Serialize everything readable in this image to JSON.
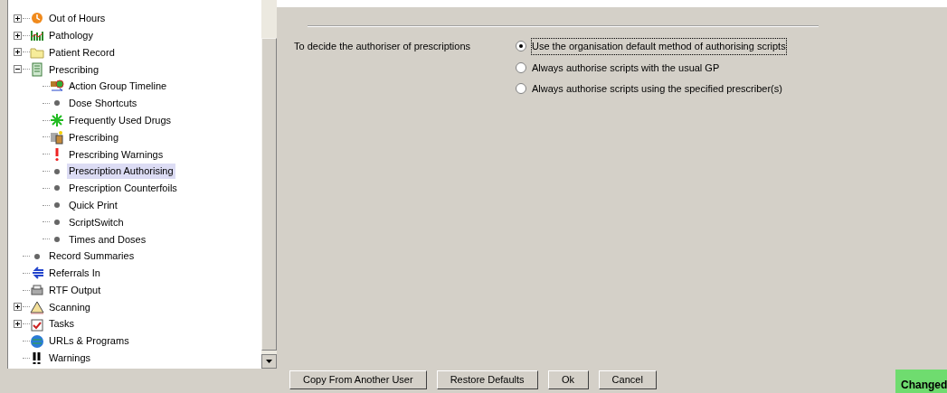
{
  "tree": {
    "items": [
      {
        "label": "Out of Hours",
        "kind": "branch",
        "expanded": false,
        "selected": false
      },
      {
        "label": "Pathology",
        "kind": "branch",
        "expanded": false,
        "selected": false
      },
      {
        "label": "Patient Record",
        "kind": "branch",
        "expanded": false,
        "selected": false
      },
      {
        "label": "Prescribing",
        "kind": "branch",
        "expanded": true,
        "selected": false,
        "children": [
          {
            "label": "Action Group Timeline",
            "selected": false
          },
          {
            "label": "Dose Shortcuts",
            "selected": false
          },
          {
            "label": "Frequently Used Drugs",
            "selected": false
          },
          {
            "label": "Prescribing",
            "selected": false
          },
          {
            "label": "Prescribing Warnings",
            "selected": false
          },
          {
            "label": "Prescription Authorising",
            "selected": true
          },
          {
            "label": "Prescription Counterfoils",
            "selected": false
          },
          {
            "label": "Quick Print",
            "selected": false
          },
          {
            "label": "ScriptSwitch",
            "selected": false
          },
          {
            "label": "Times and Doses",
            "selected": false
          }
        ]
      },
      {
        "label": "Record Summaries",
        "selected": false
      },
      {
        "label": "Referrals In",
        "selected": false
      },
      {
        "label": "RTF Output",
        "selected": false
      },
      {
        "label": "Scanning",
        "kind": "branch",
        "expanded": false,
        "selected": false
      },
      {
        "label": "Tasks",
        "kind": "branch",
        "expanded": false,
        "selected": false
      },
      {
        "label": "URLs & Programs",
        "selected": false
      },
      {
        "label": "Warnings",
        "selected": false
      }
    ]
  },
  "settings": {
    "label": "To decide the authoriser of prescriptions",
    "options": [
      {
        "label": "Use the organisation default method of authorising scripts",
        "selected": true
      },
      {
        "label": "Always authorise scripts with the usual GP",
        "selected": false
      },
      {
        "label": "Always authorise scripts using the specified prescriber(s)",
        "selected": false
      }
    ]
  },
  "buttons": [
    "Copy From Another User",
    "Restore Defaults",
    "Ok",
    "Cancel"
  ],
  "status_badge": "Changed"
}
